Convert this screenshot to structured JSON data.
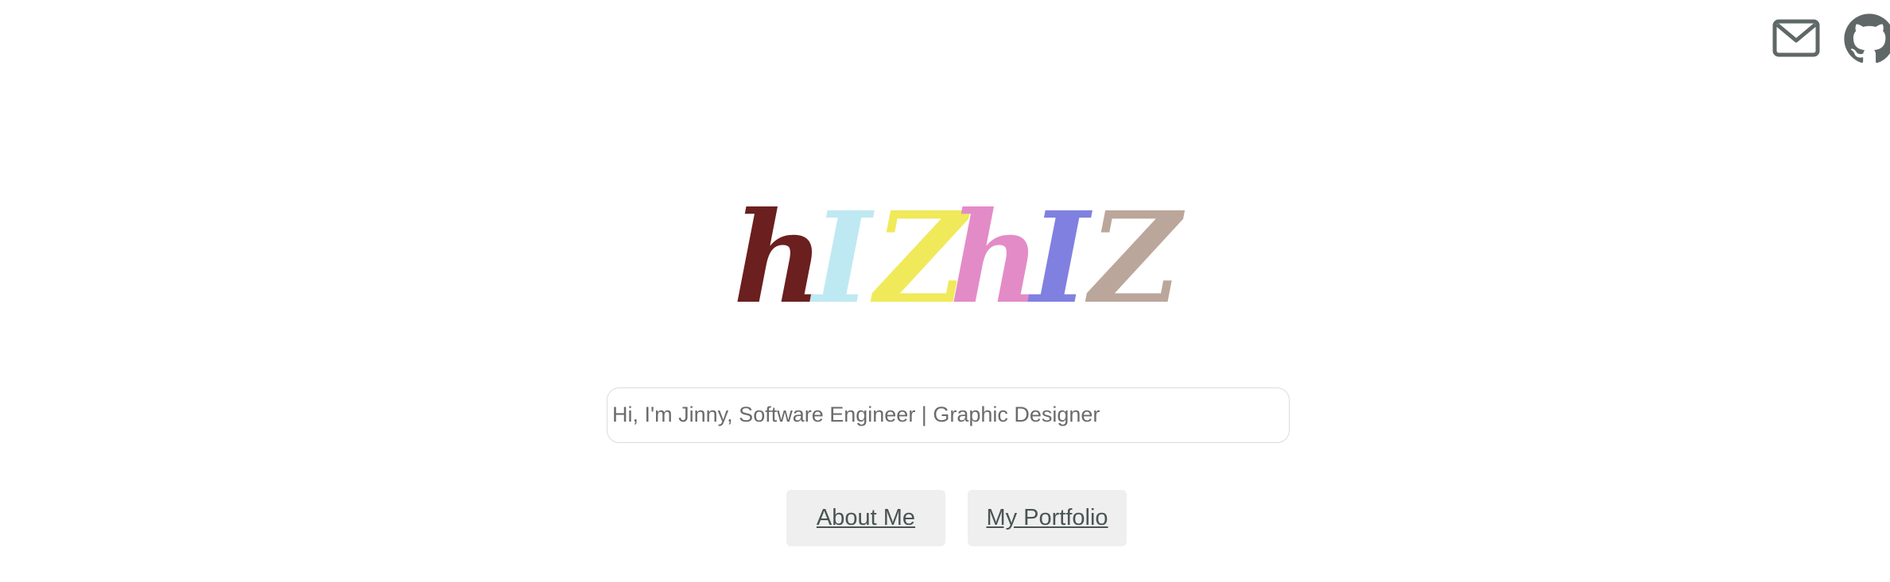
{
  "header": {
    "icons": [
      {
        "name": "mail-icon",
        "color": "#5f6866"
      },
      {
        "name": "github-icon",
        "color": "#5f6866"
      }
    ]
  },
  "logo": {
    "text": "hIZhIZ",
    "letters": [
      {
        "char": "h",
        "color": "#6b1f1f"
      },
      {
        "char": "I",
        "color": "#bfe9f2"
      },
      {
        "char": "Z",
        "color": "#f0e95a"
      },
      {
        "char": "h",
        "color": "#e38bc7"
      },
      {
        "char": "I",
        "color": "#8080e0"
      },
      {
        "char": "Z",
        "color": "#bba69b"
      }
    ]
  },
  "intro": {
    "text": "Hi, I'm Jinny, Software Engineer | Graphic Designer"
  },
  "nav": {
    "about_label": "About Me",
    "portfolio_label": "My Portfolio"
  }
}
